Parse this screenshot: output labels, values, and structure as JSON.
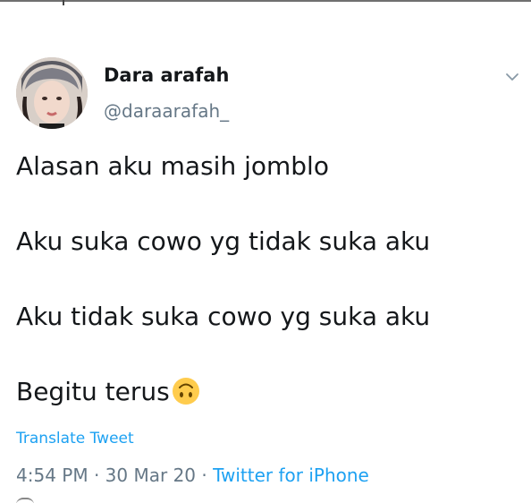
{
  "tweet": {
    "author": {
      "display_name": "Dara arafah",
      "handle": "@daraarafah_"
    },
    "lines": [
      "Alasan aku masih jomblo",
      "Aku suka cowo yg tidak suka aku",
      "Aku tidak suka cowo yg suka aku",
      "Begitu terus"
    ],
    "emoji_icon": "upside-down-face-icon",
    "translate_label": "Translate Tweet",
    "meta": {
      "time": "4:54 PM",
      "separator": " · ",
      "date": "30 Mar 20",
      "source": "Twitter for iPhone"
    }
  },
  "colors": {
    "text": "#14171a",
    "secondary": "#657786",
    "link": "#1da1f2",
    "emoji": "#ffcc4d"
  }
}
